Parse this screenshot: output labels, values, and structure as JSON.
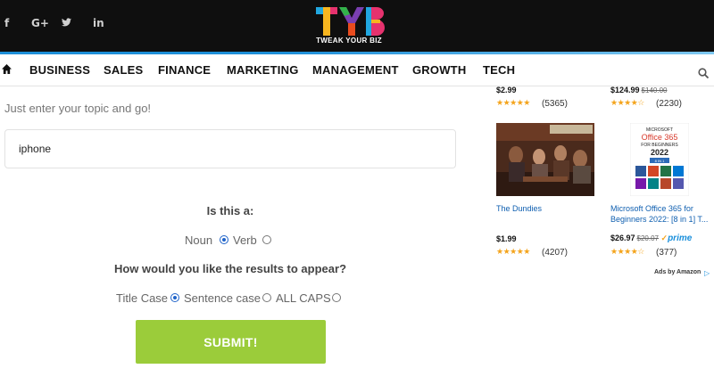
{
  "header": {
    "social": [
      {
        "name": "facebook-icon",
        "glyph": "f"
      },
      {
        "name": "google-plus-icon",
        "glyph": "G+"
      },
      {
        "name": "twitter-icon",
        "glyph": "🐦"
      },
      {
        "name": "linkedin-icon",
        "glyph": "in"
      }
    ],
    "logo_text": "TYB",
    "logo_tagline": "TWEAK YOUR BIZ"
  },
  "nav": {
    "items": [
      "BUSINESS",
      "SALES",
      "FINANCE",
      "MARKETING",
      "MANAGEMENT",
      "GROWTH",
      "TECH"
    ]
  },
  "form": {
    "intro": "Just enter your topic and go!",
    "topic_value": "iphone",
    "q1": "Is this a:",
    "q1_options": [
      "Noun",
      "Verb"
    ],
    "q1_selected": "Noun",
    "q2": "How would you like the results to appear?",
    "q2_options": [
      "Title Case",
      "Sentence case",
      "ALL CAPS"
    ],
    "q2_selected": "Title Case",
    "submit_label": "SUBMIT!"
  },
  "ads": {
    "top_left": {
      "price": "$2.99",
      "reviews": "(5365)"
    },
    "top_right": {
      "price": "$124.99",
      "old_price": "$140.00",
      "reviews": "(2230)"
    },
    "item1": {
      "title": "The Dundies",
      "price": "$1.99",
      "reviews": "(4207)"
    },
    "item2": {
      "title_line1": "Microsoft Office 365 for",
      "title_line2": "Beginners 2022: [8 in 1] T...",
      "price": "$26.97",
      "old_price": "$20.07",
      "prime": "prime",
      "reviews": "(377)",
      "cover_line1": "MICROSOFT",
      "cover_line2": "Office 365",
      "cover_line3": "FOR BEGINNERS",
      "cover_year": "2022",
      "cover_badge": "8 IN 1"
    },
    "footer": "Ads by Amazon",
    "colors": {
      "star": "#f4a41c",
      "link": "#0f5fb0",
      "prime": "#1a8fdb"
    }
  },
  "colors": {
    "submit": "#9bcc3a",
    "topbar": "#0f0f0f",
    "radio_selected": "#1f63c9"
  }
}
